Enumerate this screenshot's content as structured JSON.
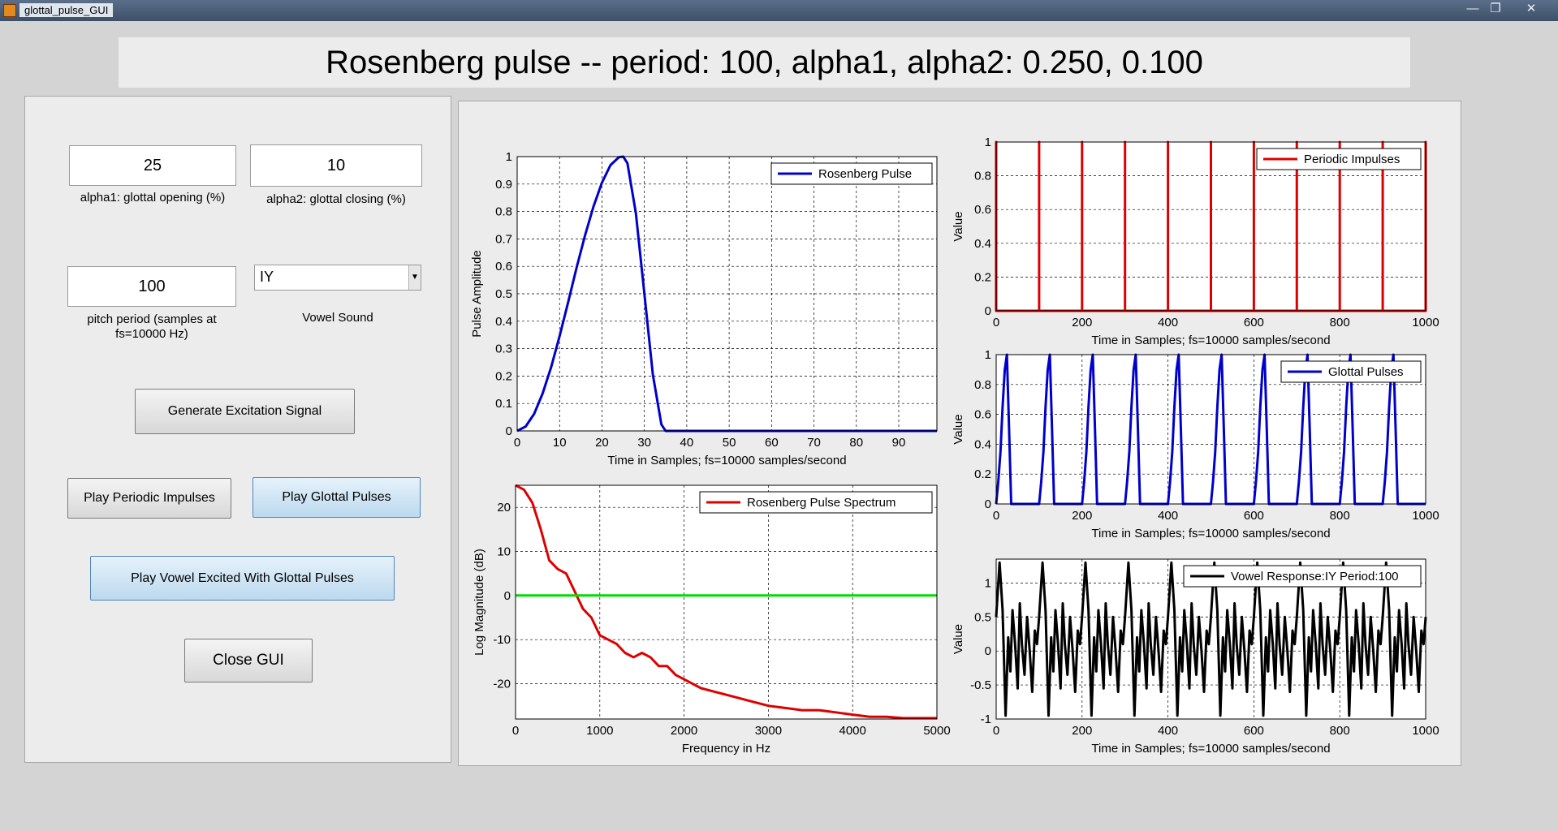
{
  "window": {
    "title": "glottal_pulse_GUI",
    "minimize": "—",
    "maximize": "❐",
    "close": "✕"
  },
  "banner": "Rosenberg pulse -- period: 100, alpha1, alpha2:  0.250,  0.100",
  "controls": {
    "alpha1_value": "25",
    "alpha1_label": "alpha1: glottal opening (%)",
    "alpha2_value": "10",
    "alpha2_label": "alpha2: glottal closing (%)",
    "period_value": "100",
    "period_label_line1": "pitch period (samples at",
    "period_label_line2": "fs=10000 Hz)",
    "vowel_value": "IY",
    "vowel_label": "Vowel Sound",
    "btn_generate": "Generate Excitation Signal",
    "btn_play_impulses": "Play Periodic Impulses",
    "btn_play_glottal": "Play Glottal Pulses",
    "btn_play_vowel": "Play Vowel Excited With Glottal Pulses",
    "btn_close": "Close GUI"
  },
  "colors": {
    "blue": "#0000cc",
    "red": "#dd0000",
    "green": "#00dd00",
    "black": "#000000"
  },
  "chart_data": [
    {
      "id": "pulse",
      "type": "line",
      "xlabel": "Time in Samples; fs=10000 samples/second",
      "ylabel": "Pulse Amplitude",
      "xlim": [
        0,
        99
      ],
      "ylim": [
        0,
        1
      ],
      "xticks": [
        0,
        10,
        20,
        30,
        40,
        50,
        60,
        70,
        80,
        90
      ],
      "yticks": [
        0,
        0.1,
        0.2,
        0.3,
        0.4,
        0.5,
        0.6,
        0.7,
        0.8,
        0.9,
        1
      ],
      "grid": true,
      "legend": "top-right",
      "series": [
        {
          "name": "Rosenberg Pulse",
          "color": "#0000cc",
          "x": [
            0,
            2,
            4,
            6,
            8,
            10,
            12,
            14,
            16,
            18,
            20,
            22,
            24,
            25,
            26,
            28,
            30,
            32,
            34,
            35,
            36,
            50,
            70,
            99
          ],
          "y": [
            0,
            0.016,
            0.062,
            0.136,
            0.232,
            0.345,
            0.468,
            0.594,
            0.713,
            0.818,
            0.905,
            0.969,
            0.998,
            1.0,
            0.976,
            0.794,
            0.5,
            0.206,
            0.024,
            0,
            0,
            0,
            0,
            0
          ]
        }
      ]
    },
    {
      "id": "spectrum",
      "type": "line",
      "xlabel": "Frequency in Hz",
      "ylabel": "Log Magnitude (dB)",
      "xlim": [
        0,
        5000
      ],
      "ylim": [
        -28,
        25
      ],
      "xticks": [
        0,
        1000,
        2000,
        3000,
        4000,
        5000
      ],
      "yticks": [
        20,
        10,
        0,
        -10,
        -20
      ],
      "grid": true,
      "legend": "top-right",
      "series": [
        {
          "name": "Rosenberg Pulse Spectrum",
          "color": "#dd0000",
          "x": [
            0,
            100,
            200,
            300,
            400,
            500,
            600,
            700,
            800,
            900,
            1000,
            1100,
            1200,
            1300,
            1400,
            1500,
            1600,
            1700,
            1800,
            1900,
            2000,
            2200,
            2400,
            2600,
            2800,
            3000,
            3200,
            3400,
            3600,
            3800,
            4000,
            4200,
            4400,
            4600,
            4800,
            5000
          ],
          "y": [
            25,
            24,
            21,
            15,
            8,
            6,
            5,
            1,
            -3,
            -5,
            -9,
            -10,
            -11,
            -13,
            -14,
            -13,
            -14,
            -16,
            -16,
            -18,
            -19,
            -21,
            -22,
            -23,
            -24,
            -25,
            -25.5,
            -26,
            -26,
            -26.5,
            -27,
            -27.5,
            -27.5,
            -27.8,
            -27.8,
            -27.8
          ]
        },
        {
          "name": "",
          "color": "#00dd00",
          "x": [
            0,
            5000
          ],
          "y": [
            0,
            0
          ]
        }
      ]
    },
    {
      "id": "impulses",
      "type": "line",
      "xlabel": "Time in Samples; fs=10000 samples/second",
      "ylabel": "Value",
      "xlim": [
        0,
        1000
      ],
      "ylim": [
        0,
        1
      ],
      "xticks": [
        0,
        200,
        400,
        600,
        800,
        1000
      ],
      "yticks": [
        0,
        0.2,
        0.4,
        0.6,
        0.8,
        1
      ],
      "grid": true,
      "legend": "top-right",
      "series": [
        {
          "name": "Periodic Impulses",
          "color": "#dd0000",
          "impulses_at": [
            0,
            100,
            200,
            300,
            400,
            500,
            600,
            700,
            800,
            900,
            1000
          ]
        }
      ]
    },
    {
      "id": "glottal",
      "type": "line",
      "xlabel": "Time in Samples; fs=10000 samples/second",
      "ylabel": "Value",
      "xlim": [
        0,
        1000
      ],
      "ylim": [
        0,
        1
      ],
      "xticks": [
        0,
        200,
        400,
        600,
        800,
        1000
      ],
      "yticks": [
        0,
        0.2,
        0.4,
        0.6,
        0.8,
        1
      ],
      "grid": true,
      "legend": "top-right",
      "series": [
        {
          "name": "Glottal Pulses",
          "color": "#0000cc",
          "period": 100,
          "pulse_x": [
            0,
            5,
            10,
            15,
            20,
            25,
            30,
            35
          ],
          "pulse_y": [
            0,
            0.15,
            0.35,
            0.65,
            0.9,
            1.0,
            0.5,
            0
          ]
        }
      ]
    },
    {
      "id": "vowel",
      "type": "line",
      "xlabel": "Time in Samples; fs=10000 samples/second",
      "ylabel": "Value",
      "xlim": [
        0,
        1000
      ],
      "ylim": [
        -1,
        1.35
      ],
      "xticks": [
        0,
        200,
        400,
        600,
        800,
        1000
      ],
      "yticks": [
        -1,
        -0.5,
        0,
        0.5,
        1
      ],
      "grid": true,
      "legend": "top-right",
      "series": [
        {
          "name": "Vowel Response:IY  Period:100",
          "color": "#000000",
          "period": 100,
          "cycle_x": [
            0,
            8,
            15,
            22,
            28,
            33,
            38,
            44,
            50,
            55,
            60,
            66,
            72,
            78,
            84,
            90,
            95,
            100
          ],
          "cycle_y": [
            0.5,
            1.3,
            0.6,
            -0.95,
            0.2,
            -0.3,
            0.6,
            0.1,
            -0.55,
            0.7,
            0.1,
            -0.35,
            0.5,
            0.0,
            -0.6,
            0.3,
            0.1,
            0.5
          ]
        }
      ]
    }
  ]
}
